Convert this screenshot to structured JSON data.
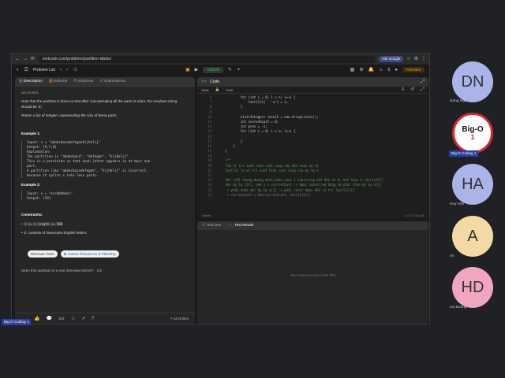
{
  "browser": {
    "url": "leetcode.com/problems/partition-labels/",
    "ask_google": "Ask Google"
  },
  "topnav": {
    "problem_list": "Problem List",
    "submit": "Submit",
    "premium": "Premium",
    "count": "0"
  },
  "left": {
    "tabs": [
      "Description",
      "Editorial",
      "Solutions",
      "Submissions"
    ],
    "top_fragment": "are invalid.",
    "note": "Note that the partition is done so that after concatenating all the parts in order, the resultant string should be",
    "note_code": "s",
    "ret_prefix": "Return",
    "ret_italic": "a list of integers representing the size of these parts.",
    "ex1_title": "Example 1:",
    "ex1_lines": [
      "Input: s = \"ababcbacadefegdehijhklij\"",
      "Output: [9,7,8]",
      "Explanation:",
      "The partition is \"ababcbaca\", \"defegde\", \"hijhklij\".",
      "This is a partition so that each letter appears in at most one",
      "part.",
      "A partition like \"ababcbacadefegde\", \"hijhklij\" is incorrect,",
      "because it splits s into less parts."
    ],
    "ex2_title": "Example 2:",
    "ex2_lines": [
      "Input: s = \"eccbbbbdec\"",
      "Output: [10]"
    ],
    "constraints_title": "Constraints:",
    "c1": "1 <= s.length <= 500",
    "c2_code": "s",
    "c2_text": "consists of lowercase English letters.",
    "discover": "Discover more",
    "career": "Career Resources & Planning",
    "seen": "Seen this question in a real interview before?",
    "seen_count": "1/6",
    "foot_likes": "261",
    "foot_online": "14 Online"
  },
  "code": {
    "title": "Code",
    "lang": "Java",
    "auto": "Auto",
    "lines": [
      {
        "n": "6",
        "t": "            for (int j = 0; i < n; i++) {",
        "c": false
      },
      {
        "n": "7",
        "t": "                last[s[i] - 'a'] = i;",
        "c": false
      },
      {
        "n": "8",
        "t": "            }",
        "c": false
      },
      {
        "n": "9",
        "t": "",
        "c": false
      },
      {
        "n": "10",
        "t": "            List<Integer> result = new ArrayList<>();",
        "c": false
      },
      {
        "n": "11",
        "t": "            int currentLast = 0;",
        "c": false
      },
      {
        "n": "12",
        "t": "            int prev = -1;",
        "c": false
      },
      {
        "n": "13",
        "t": "            for (int i = 0; i < n; i++) {",
        "c": false
      },
      {
        "n": "14",
        "t": "",
        "c": false
      },
      {
        "n": "15",
        "t": "            }",
        "c": false
      },
      {
        "n": "16",
        "t": "        }",
        "c": false
      },
      {
        "n": "17",
        "t": "    }",
        "c": false
      },
      {
        "n": "18",
        "t": "",
        "c": false
      },
      {
        "n": "19",
        "t": "    /**",
        "c": true
      },
      {
        "n": "20",
        "t": "    Tìm vị trí xuất hiện cuối cùng của mỗi loại ký tự",
        "c": true
      },
      {
        "n": "21",
        "t": "    last[x] là vị trí xuất hiện cuối cùng của ký tự x",
        "c": true
      },
      {
        "n": "22",
        "t": "",
        "c": true
      },
      {
        "n": "23",
        "t": "    Với s[0] tương đương mình phải chọn 1 substring bắt đầu từ 0, kết thúc ở last[s[0]]",
        "c": true
      },
      {
        "n": "24",
        "t": "    Với ký tự s[1], nếu 1 > currentLast -> được substring đúng và phải chứa ký tự s[1]",
        "c": true
      },
      {
        "n": "25",
        "t": "    -> phải chứa mọi ký tự s[1] -> phải cover được đến vị trí last[s[1]]",
        "c": true
      },
      {
        "n": "26",
        "t": "    -> currentLast = max(currentLast, last[s[1]])",
        "c": true
      }
    ],
    "saved": "Saved",
    "pos": "Ln 13, Col 18"
  },
  "test": {
    "tab1": "Testcase",
    "tab2": "Test Result",
    "placeholder": "You must run your code first"
  },
  "participants": [
    {
      "initials": "DN",
      "name": "Dang Ngo",
      "color": "#aab4e8"
    },
    {
      "initials": "",
      "name": "",
      "color": "#ffffff"
    },
    {
      "initials": "HA",
      "name": "Huy Anh",
      "color": "#aab4e8"
    },
    {
      "initials": "A",
      "name": "An",
      "color": "#f3d9a4"
    },
    {
      "initials": "HD",
      "name": "Ha Duong",
      "color": "#f0a6c0"
    }
  ],
  "logo": {
    "text": "Big-O",
    "digit": "1"
  },
  "tag_label": "Big-O Coding 1"
}
